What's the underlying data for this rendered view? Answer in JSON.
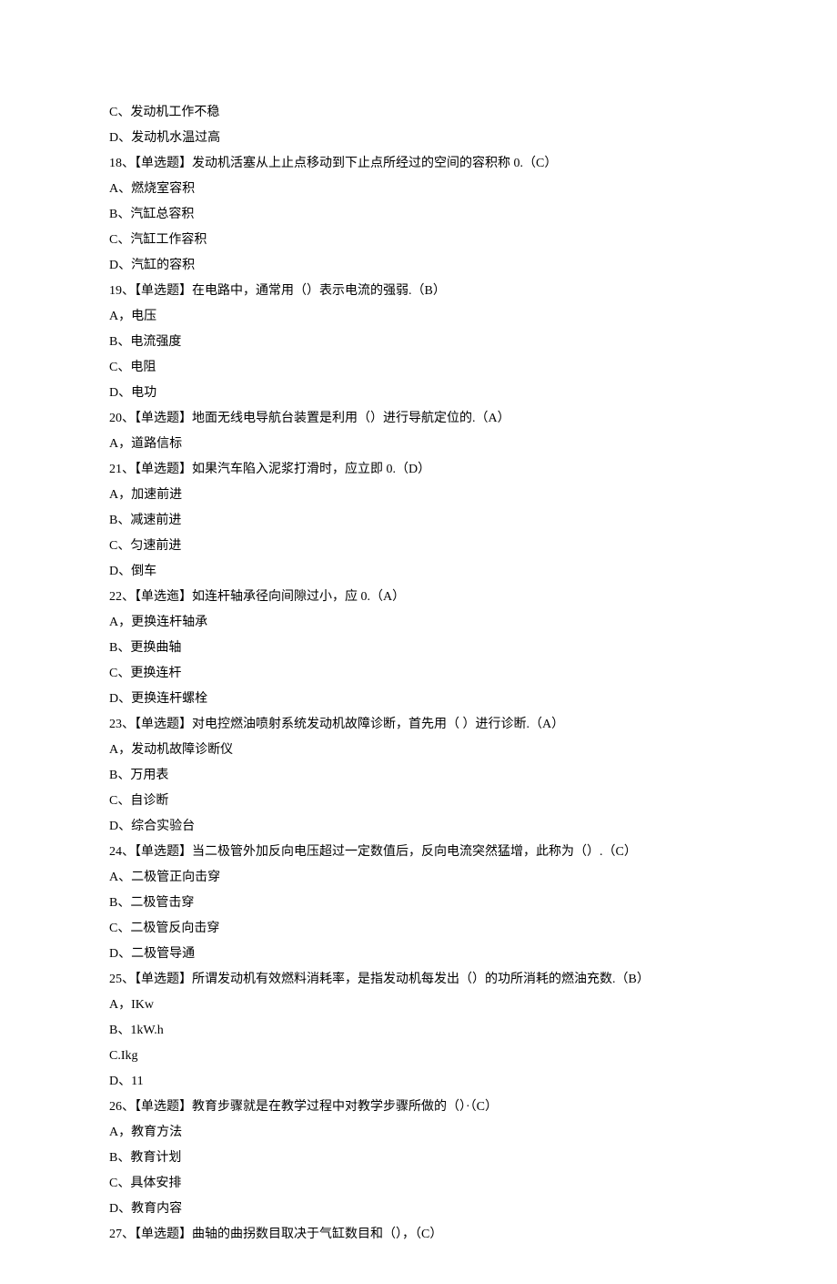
{
  "lines": [
    "C、发动机工作不稳",
    "D、发动机水温过高",
    "18、【单选题】发动机活塞从上止点移动到下止点所经过的空间的容积称 0.（C）",
    "A、燃烧室容积",
    "B、汽缸总容积",
    "C、汽缸工作容积",
    "D、汽缸的容积",
    "19、【单选题】在电路中，通常用（）表示电流的强弱.（B）",
    "A，电压",
    "B、电流强度",
    "C、电阻",
    "D、电功",
    "20、【单选题】地面无线电导航台装置是利用（）进行导航定位的.（A）",
    "A，道路信标",
    "21、【单选题】如果汽车陷入泥浆打滑时，应立即 0.（D）",
    "A，加速前进",
    "B、减速前进",
    "C、匀速前进",
    "D、倒车",
    "22、【单选迤】如连杆轴承径向间隙过小，应 0.（A）",
    "A，更换连杆轴承",
    "B、更换曲轴",
    "C、更换连杆",
    "D、更换连杆螺栓",
    "23、【单选题】对电控燃油喷射系统发动机故障诊断，首先用（ ）进行诊断.（A）",
    "A，发动机故障诊断仪",
    "B、万用表",
    "C、自诊断",
    "D、综合实验台",
    "24、【单选题】当二极管外加反向电压超过一定数值后，反向电流突然猛增，此称为（）.（C）",
    "A、二极管正向击穿",
    "B、二极管击穿",
    "C、二极管反向击穿",
    "D、二极管导通",
    "25、【单选题】所谓发动机有效燃料消耗率，是指发动机每发出（）的功所消耗的燃油充数.（B）",
    "A，IKw",
    "B、1kW.h",
    "C.Ikg",
    "D、11",
    "26、【单选题】教育步骤就是在教学过程中对教学步骤所做的（）·（C）",
    "A，教育方法",
    "B、教育计划",
    "C、具体安排",
    "D、教育内容",
    "27、【单选题】曲轴的曲拐数目取决于气缸数目和（），（C）"
  ]
}
